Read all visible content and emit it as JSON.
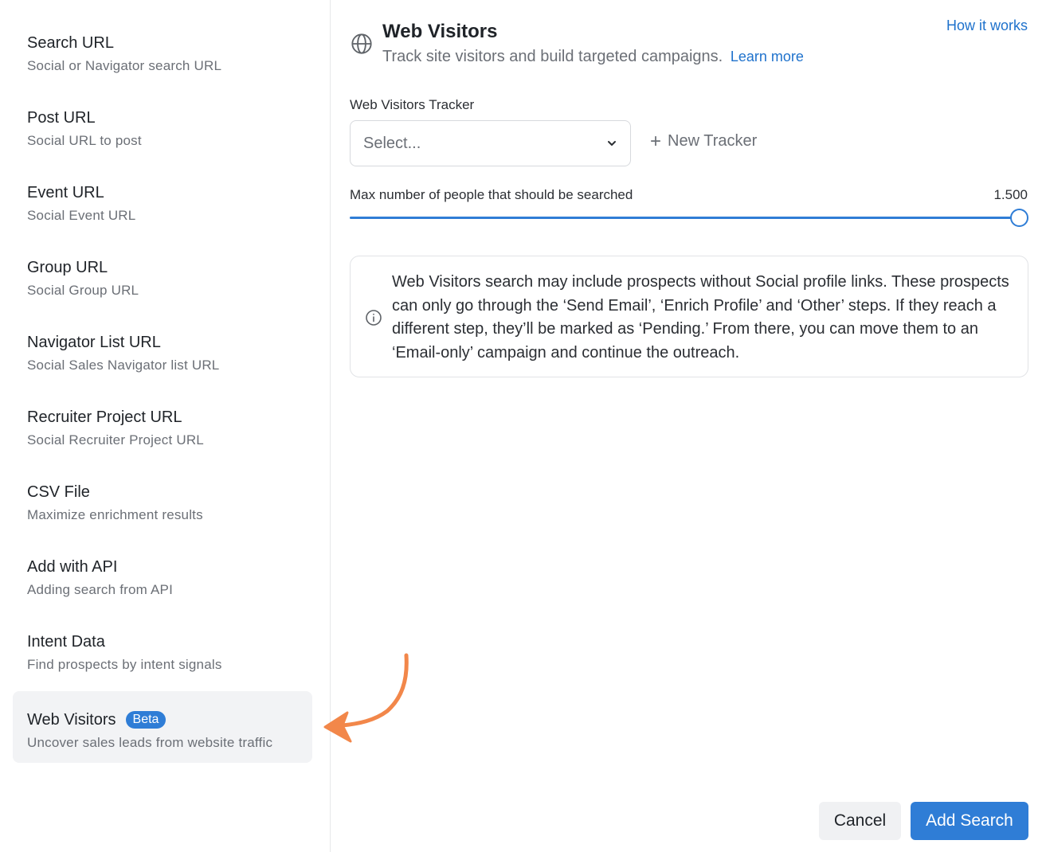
{
  "sidebar": {
    "items": [
      {
        "title": "Search URL",
        "subtitle": "Social or Navigator search URL"
      },
      {
        "title": "Post URL",
        "subtitle": "Social URL to post"
      },
      {
        "title": "Event URL",
        "subtitle": "Social Event URL"
      },
      {
        "title": "Group URL",
        "subtitle": "Social Group URL"
      },
      {
        "title": "Navigator List URL",
        "subtitle": "Social Sales Navigator list URL"
      },
      {
        "title": "Recruiter Project URL",
        "subtitle": "Social Recruiter Project URL"
      },
      {
        "title": "CSV File",
        "subtitle": "Maximize enrichment results"
      },
      {
        "title": "Add with API",
        "subtitle": "Adding search from API"
      },
      {
        "title": "Intent Data",
        "subtitle": "Find prospects by intent signals"
      },
      {
        "title": "Web Visitors",
        "subtitle": "Uncover sales leads from website traffic",
        "badge": "Beta",
        "active": true
      }
    ]
  },
  "header": {
    "title": "Web Visitors",
    "subtitle": "Track site visitors and build targeted campaigns.",
    "learn_more": "Learn more",
    "how_it_works": "How it works",
    "icon": "globe-icon"
  },
  "tracker": {
    "label": "Web Visitors Tracker",
    "select_placeholder": "Select...",
    "new_tracker": "New Tracker"
  },
  "slider": {
    "label": "Max number of people that should be searched",
    "value_text": "1.500",
    "fraction": 1.0
  },
  "info": {
    "text": "Web Visitors search may include prospects without Social profile links. These prospects can only go through the ‘Send Email’, ‘Enrich Profile’ and ‘Other’ steps. If they reach a different step, they’ll be marked as ‘Pending.’ From there, you can move them to an ‘Email-only’ campaign and continue the outreach."
  },
  "footer": {
    "cancel": "Cancel",
    "add_search": "Add Search"
  },
  "colors": {
    "accent": "#2f7dd6",
    "link": "#1f72cc",
    "arrow": "#f2874a",
    "active_bg": "#f2f3f5"
  }
}
